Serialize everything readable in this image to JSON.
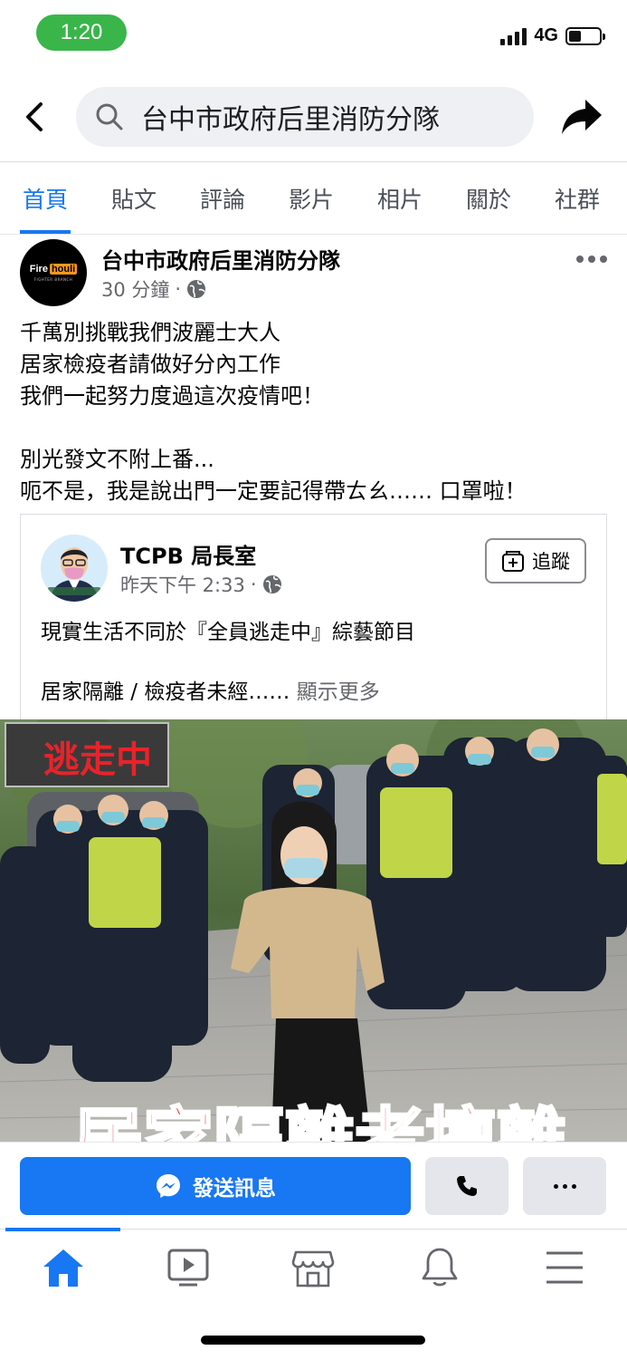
{
  "status_bar": {
    "time": "1:20",
    "network": "4G"
  },
  "search": {
    "query": "台中市政府后里消防分隊"
  },
  "tabs": [
    {
      "label": "首頁",
      "active": true
    },
    {
      "label": "貼文"
    },
    {
      "label": "評論"
    },
    {
      "label": "影片"
    },
    {
      "label": "相片"
    },
    {
      "label": "關於"
    },
    {
      "label": "社群"
    }
  ],
  "post": {
    "author": "台中市政府后里消防分隊",
    "time": "30 分鐘",
    "separator": "·",
    "avatar_logo": {
      "fire": "Fire",
      "houli": "houli",
      "sub": "FIGHTER BRANCH"
    },
    "text_lines": [
      "千萬別挑戰我們波麗士大人",
      "居家檢疫者請做好分內工作",
      "我們一起努力度過這次疫情吧！",
      "",
      "別光發文不附上番...",
      "呃不是，我是說出門一定要記得帶ㄊㄠ…… 口罩啦！"
    ]
  },
  "shared": {
    "name": "TCPB 局長室",
    "time": "昨天下午 2:33",
    "separator": "·",
    "follow_label": "追蹤",
    "text1": "現實生活不同於『全員逃走中』綜藝節目",
    "text2": "居家隔離 / 檢疫者未經……",
    "see_more": "顯示更多"
  },
  "image": {
    "logo_text": "逃走中",
    "banner_text": "居家隔離者擅離"
  },
  "actions": {
    "send_message": "發送訊息"
  },
  "colors": {
    "brand": "#1877f2",
    "time_pill": "#39b54a"
  },
  "bottom_nav_icons": [
    "home-icon",
    "video-icon",
    "marketplace-icon",
    "bell-icon",
    "menu-icon"
  ]
}
